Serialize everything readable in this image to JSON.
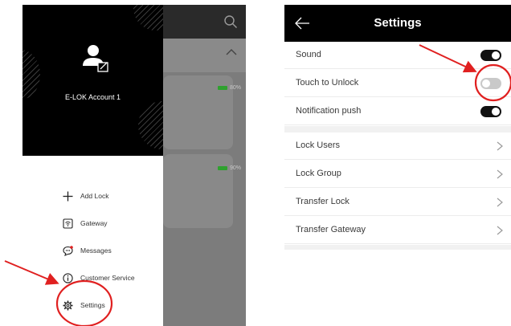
{
  "left_screen": {
    "drawer": {
      "account_name": "E-LOK Account 1",
      "menu": [
        {
          "label": "Add Lock",
          "icon": "plus-icon"
        },
        {
          "label": "Gateway",
          "icon": "gateway-icon"
        },
        {
          "label": "Messages",
          "icon": "message-icon"
        },
        {
          "label": "Customer Service",
          "icon": "info-icon"
        },
        {
          "label": "Settings",
          "icon": "gear-icon"
        }
      ]
    },
    "background_app": {
      "locks": [
        {
          "battery": "80%"
        },
        {
          "battery": "90%"
        }
      ]
    }
  },
  "right_screen": {
    "title": "Settings",
    "toggles": [
      {
        "label": "Sound",
        "on": true
      },
      {
        "label": "Touch to Unlock",
        "on": false
      },
      {
        "label": "Notification push",
        "on": true
      }
    ],
    "links": [
      {
        "label": "Lock Users"
      },
      {
        "label": "Lock Group"
      },
      {
        "label": "Transfer Lock"
      },
      {
        "label": "Transfer Gateway"
      }
    ]
  },
  "colors": {
    "header": "#000000",
    "annotation": "#e02020",
    "battery": "#2fa12f",
    "toggle_on": "#111111",
    "toggle_off": "#c9c9c9"
  }
}
